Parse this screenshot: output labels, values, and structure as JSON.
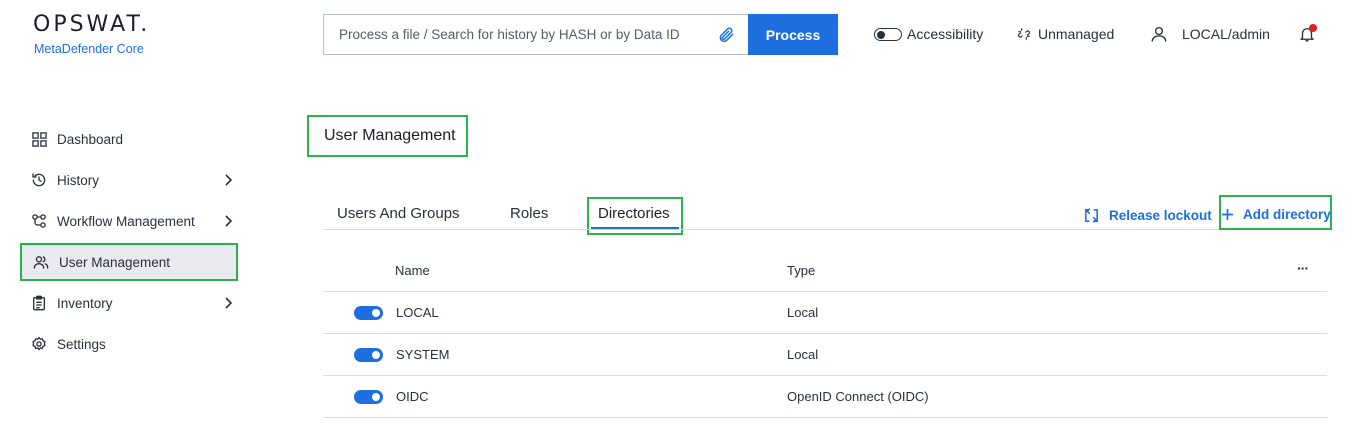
{
  "brand": {
    "name": "OPSWAT.",
    "product": "MetaDefender Core"
  },
  "header": {
    "search_placeholder": "Process a file / Search for history by HASH or by Data ID",
    "process_label": "Process",
    "accessibility_label": "Accessibility",
    "unmanaged_label": "Unmanaged",
    "user_label": "LOCAL/admin",
    "notification_dot_color": "#e02020"
  },
  "sidebar": {
    "items": [
      {
        "label": "Dashboard",
        "icon": "dashboard-icon",
        "has_children": false
      },
      {
        "label": "History",
        "icon": "history-icon",
        "has_children": true
      },
      {
        "label": "Workflow Management",
        "icon": "workflow-icon",
        "has_children": true
      },
      {
        "label": "User Management",
        "icon": "users-icon",
        "has_children": false,
        "active": true
      },
      {
        "label": "Inventory",
        "icon": "clipboard-icon",
        "has_children": true
      },
      {
        "label": "Settings",
        "icon": "gear-icon",
        "has_children": false
      }
    ]
  },
  "main": {
    "title": "User Management",
    "tabs": [
      {
        "label": "Users And Groups"
      },
      {
        "label": "Roles"
      },
      {
        "label": "Directories",
        "active": true
      }
    ],
    "actions": {
      "release_lockout": "Release lockout",
      "add_directory": "Add directory"
    },
    "table": {
      "columns": [
        "Name",
        "Type"
      ],
      "more_label": "···",
      "rows": [
        {
          "name": "LOCAL",
          "type": "Local",
          "enabled": true
        },
        {
          "name": "SYSTEM",
          "type": "Local",
          "enabled": true
        },
        {
          "name": "OIDC",
          "type": "OpenID Connect (OIDC)",
          "enabled": true
        }
      ]
    }
  },
  "colors": {
    "accent": "#1d6fe0",
    "highlight": "#2bb24c"
  }
}
